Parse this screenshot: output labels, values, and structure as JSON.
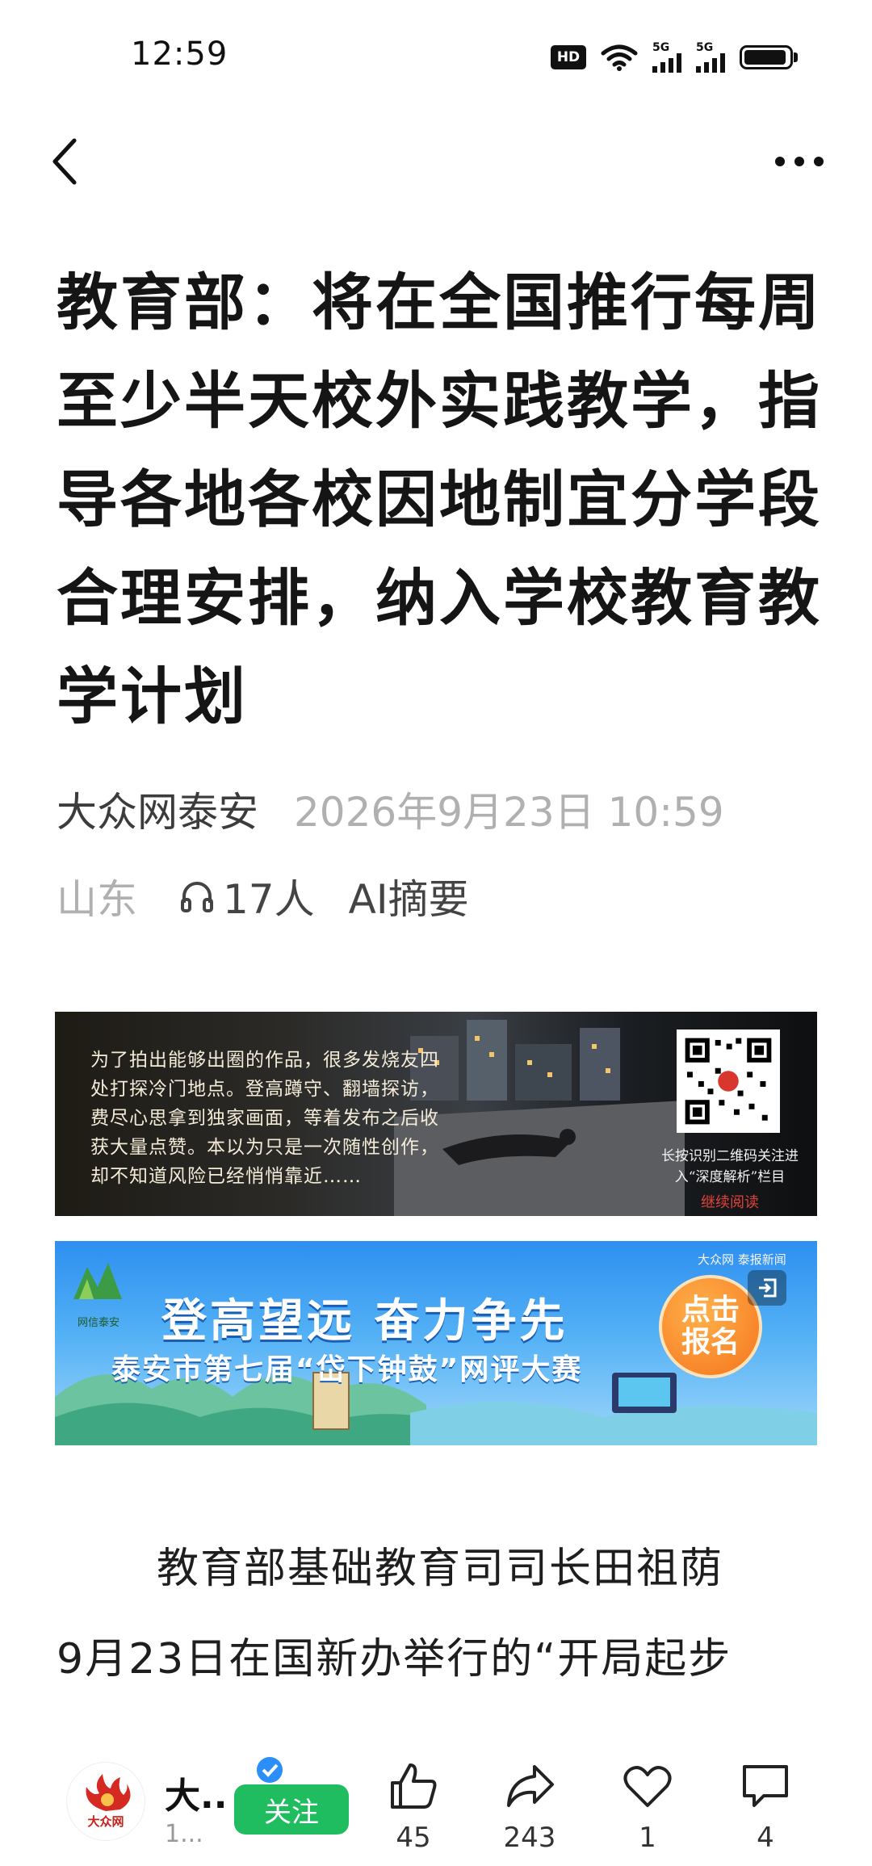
{
  "status_bar": {
    "time": "12:59",
    "hd_label": "HD",
    "network_1": "5G",
    "network_2": "5G"
  },
  "nav": {
    "back_icon": "chevron-left-icon",
    "more_icon": "more-dots-icon"
  },
  "article": {
    "title": "教育部：将在全国推行每周至少半天校外实践教学，指导各地各校因地制宜分学段合理安排，纳入学校教育教学计划",
    "source": "大众网泰安",
    "datetime": "2026年9月23日 10:59",
    "location": "山东",
    "listeners": "17人",
    "ai_summary_label": "AI摘要",
    "body_lines": [
      "教育部基础教育司司长田祖荫",
      "9月23日在国新办举行的“开局起步"
    ]
  },
  "banner_ad": {
    "text": "为了拍出能够出圈的作品，很多发烧友四处打探冷门地点。登高蹲守、翻墙探访，费尽心思拿到独家画面，等着发布之后收获大量点赞。本以为只是一次随性创作，却不知道风险已经悄悄靠近……",
    "qr_caption": "长按识别二维码关注进入“深度解析”栏目",
    "continue_label": "继续阅读"
  },
  "banner_event": {
    "logo_label": "网信泰安",
    "brand": "大众网 泰报新闻",
    "headline": "登高望远 奋力争先",
    "subline": "泰安市第七届“岱下钟鼓”网评大赛",
    "cta": [
      "点击",
      "报名"
    ]
  },
  "bottom_bar": {
    "author_name": "大..",
    "author_sub": "1...",
    "avatar_text": "大众网",
    "follow_label": "关注",
    "like_count": "45",
    "share_count": "243",
    "favorite_count": "1",
    "comment_count": "4"
  },
  "colors": {
    "follow_green": "#1fbd5f",
    "meta_gray": "#b0b0b0",
    "banner_blue": "#2e8ff0"
  }
}
